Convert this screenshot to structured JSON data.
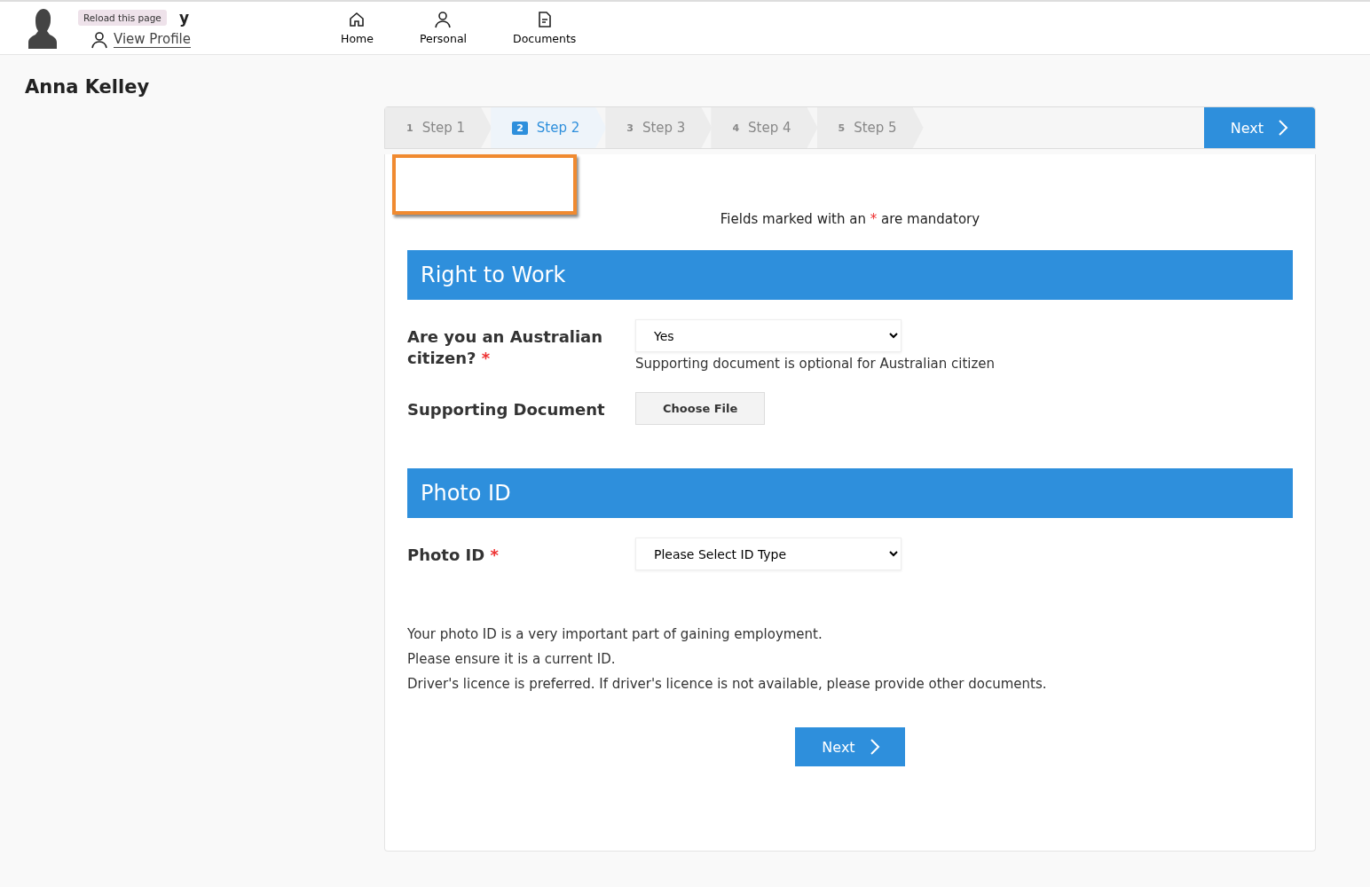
{
  "header": {
    "tooltip": "Reload this page",
    "name_visible": "y",
    "profile_link": "View Profile",
    "nav": [
      {
        "label": "Home",
        "kind": "home"
      },
      {
        "label": "Personal",
        "kind": "person"
      },
      {
        "label": "Documents",
        "kind": "document"
      }
    ]
  },
  "page_title": "Anna Kelley",
  "wizard": {
    "steps": [
      {
        "number": "1",
        "label": "Step 1",
        "selected": false
      },
      {
        "number": "2",
        "label": "Step 2",
        "selected": true
      },
      {
        "number": "3",
        "label": "Step 3",
        "selected": false
      },
      {
        "number": "4",
        "label": "Step 4",
        "selected": false
      },
      {
        "number": "5",
        "label": "Step 5",
        "selected": false
      }
    ],
    "next_button": "Next"
  },
  "mandatory_note": {
    "before": "Fields marked with an",
    "mark": "*",
    "after": "are mandatory"
  },
  "sections": [
    {
      "title": "Right to Work",
      "fields": [
        {
          "kind": "select",
          "label": "Are you an Australian citizen?",
          "required": true,
          "value": "Yes",
          "help": "Supporting document is optional for Australian citizen"
        },
        {
          "kind": "file",
          "label": "Supporting Document",
          "required": false,
          "button": "Choose File"
        }
      ]
    },
    {
      "title": "Photo ID",
      "fields": [
        {
          "kind": "select",
          "label": "Photo ID",
          "required": true,
          "value": "Please Select ID Type"
        }
      ]
    }
  ],
  "notes": [
    "Your photo ID is a very important part of gaining employment.",
    "Please ensure it is a current ID.",
    "Driver's licence is preferred. If driver's licence is not available, please provide other documents."
  ],
  "bottom_button": "Next"
}
